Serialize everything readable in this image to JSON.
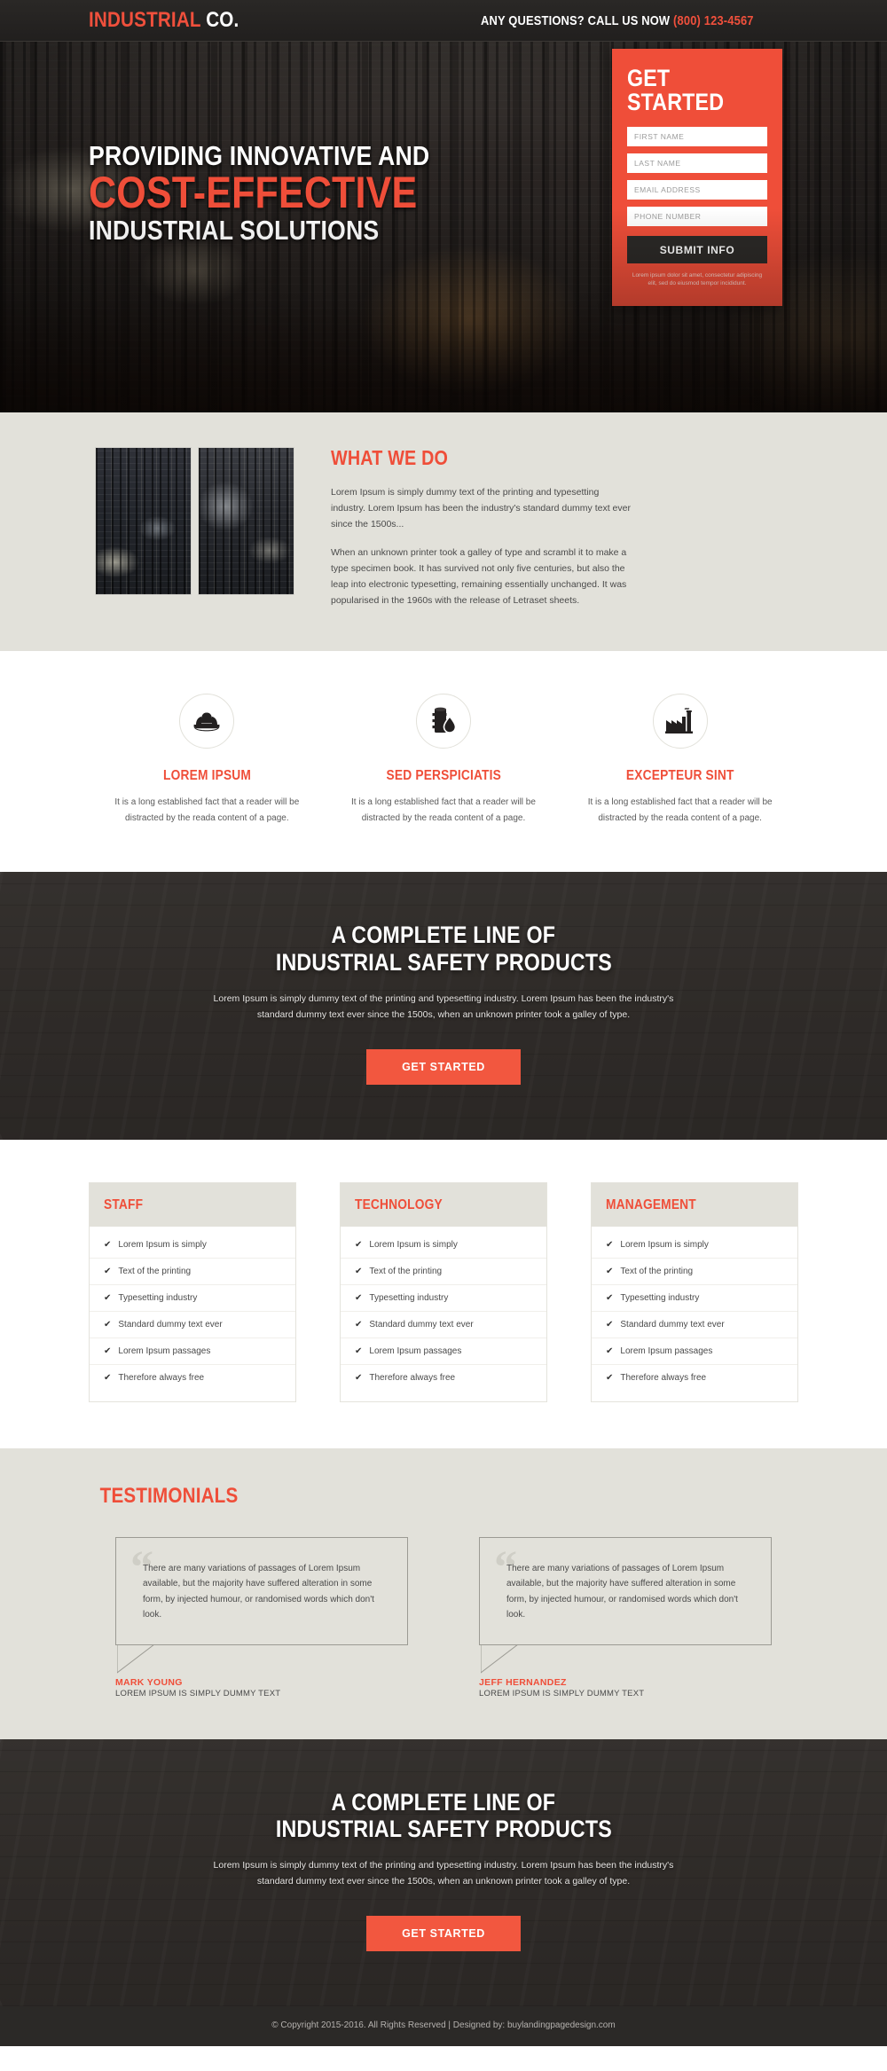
{
  "topbar": {
    "logo_strong": "INDUSTRIAL",
    "logo_light": " CO.",
    "call_text": "ANY QUESTIONS? CALL US NOW ",
    "call_number": "(800) 123-4567"
  },
  "hero": {
    "headline_line1": "PROVIDING INNOVATIVE AND",
    "headline_line2": "COST-EFFECTIVE",
    "headline_line3": "INDUSTRIAL SOLUTIONS",
    "form": {
      "title": "GET STARTED",
      "first_name_placeholder": "FIRST NAME",
      "last_name_placeholder": "LAST NAME",
      "email_placeholder": "EMAIL ADDRESS",
      "phone_placeholder": "PHONE NUMBER",
      "first_name_value": "",
      "last_name_value": "",
      "email_value": "",
      "phone_value": "",
      "submit_label": "SUBMIT INFO",
      "note": "Lorem ipsum dolor sit amet, consectetur adipiscing elit, sed do eiusmod tempor incididunt."
    }
  },
  "what_we_do": {
    "title": "WHAT WE DO",
    "paragraph1": "Lorem Ipsum is simply dummy text of the printing and typesetting industry. Lorem Ipsum has been the industry's standard dummy text ever since the 1500s...",
    "paragraph2": "When an unknown printer took a galley of type and scrambl it to make a type specimen book. It has survived not only five centuries, but also the leap into electronic typesetting, remaining essentially unchanged. It was popularised in the 1960s with the release of Letraset sheets.",
    "image1_alt": "industrial-plant-photo-1",
    "image2_alt": "industrial-plant-photo-2"
  },
  "features": [
    {
      "icon": "hard-hat-icon",
      "title": "LOREM IPSUM",
      "text": "It is a long established fact that a reader will be distracted by the reada content of a page."
    },
    {
      "icon": "oil-barrel-drop-icon",
      "title": "SED PERSPICIATIS",
      "text": "It is a long established fact that a reader will be distracted by the reada content of a page."
    },
    {
      "icon": "factory-icon",
      "title": "EXCEPTEUR SINT",
      "text": "It is a long established fact that a reader will be distracted by the reada content of a page."
    }
  ],
  "cta_top": {
    "title_line1": "A COMPLETE LINE OF",
    "title_line2": "INDUSTRIAL SAFETY PRODUCTS",
    "text": "Lorem Ipsum is simply dummy text of the printing and typesetting industry. Lorem Ipsum has been the industry's standard dummy text ever since the 1500s, when an unknown printer took a galley of type.",
    "button_label": "GET STARTED"
  },
  "cards": [
    {
      "title": "STAFF",
      "items": [
        "Lorem Ipsum is simply",
        "Text of the printing",
        "Typesetting industry",
        "Standard dummy text ever",
        "Lorem Ipsum passages",
        "Therefore always free"
      ]
    },
    {
      "title": "TECHNOLOGY",
      "items": [
        "Lorem Ipsum is simply",
        "Text of the printing",
        "Typesetting industry",
        "Standard dummy text ever",
        "Lorem Ipsum passages",
        "Therefore always free"
      ]
    },
    {
      "title": "MANAGEMENT",
      "items": [
        "Lorem Ipsum is simply",
        "Text of the printing",
        "Typesetting industry",
        "Standard dummy text ever",
        "Lorem Ipsum passages",
        "Therefore always free"
      ]
    }
  ],
  "testimonials": {
    "title": "TESTIMONIALS",
    "items": [
      {
        "quote": "There are many variations of passages of Lorem Ipsum available, but the majority have suffered alteration in some form, by injected humour, or randomised words which don't look.",
        "name": "MARK YOUNG",
        "role": "LOREM IPSUM IS SIMPLY DUMMY TEXT"
      },
      {
        "quote": "There are many variations of passages of Lorem Ipsum available, but the majority have suffered alteration in some form, by injected humour, or randomised words which don't look.",
        "name": "JEFF HERNANDEZ",
        "role": "LOREM IPSUM IS SIMPLY DUMMY TEXT"
      }
    ]
  },
  "cta_bottom": {
    "title_line1": "A COMPLETE LINE OF",
    "title_line2": "INDUSTRIAL SAFETY PRODUCTS",
    "text": "Lorem Ipsum is simply dummy text of the printing and typesetting industry. Lorem Ipsum has been the industry's standard dummy text ever since the 1500s, when an unknown printer took a galley of type.",
    "button_label": "GET STARTED"
  },
  "footer": {
    "text": "© Copyright 2015-2016. All Rights Reserved  |  Designed by: buylandingpagedesign.com"
  },
  "colors": {
    "accent": "#ef4e39",
    "dark": "#2b2927",
    "beige": "#e2e1da"
  }
}
